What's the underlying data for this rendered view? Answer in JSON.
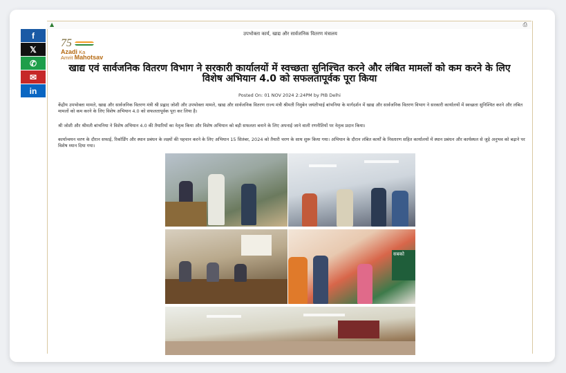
{
  "ministry_header": "उपभोक्ता कार्य, खाद्य और सार्वजनिक वितरण मंत्रालय",
  "logo": {
    "number": "75",
    "line1_prefix": "Azadi",
    "line1_suffix": "Ka",
    "line2_prefix": "Amrit",
    "line2_suffix": "Mahotsav"
  },
  "share_buttons": [
    {
      "label": "f",
      "icon": "facebook-icon",
      "color": "#1a5aa5"
    },
    {
      "label": "𝕏",
      "icon": "x-twitter-icon",
      "color": "#111111"
    },
    {
      "label": "✆",
      "icon": "whatsapp-icon",
      "color": "#1e9e4a"
    },
    {
      "label": "✉",
      "icon": "mail-icon",
      "color": "#c62828"
    },
    {
      "label": "in",
      "icon": "linkedin-icon",
      "color": "#0a66c2"
    }
  ],
  "headline": "खाद्य एवं सार्वजनिक वितरण विभाग ने सरकारी कार्यालयों में स्वच्छता सुनिश्चित करने और लंबित मामलों को कम करने के लिए विशेष अभियान 4.0 को सफलतापूर्वक पूरा किया",
  "posted": "Posted On: 01 NOV 2024 2:24PM by PIB Delhi",
  "paragraphs": [
    "केंद्रीय उपभोक्ता मामले, खाद्य और सार्वजनिक वितरण मंत्री श्री प्रह्लाद जोशी और उपभोक्ता मामले, खाद्य और सार्वजनिक वितरण राज्य मंत्री श्रीमती निमुबेन जयंतीभाई बांभनिया के मार्गदर्शन में खाद्य और सार्वजनिक वितरण विभाग ने सरकारी कार्यालयों में स्वच्छता सुनिश्चित करने और लंबित मामलों को कम करने के लिए विशेष अभियान 4.0 को सफलतापूर्वक पूरा कर लिया है।",
    "श्री जोशी और श्रीमती बांभनिया ने विशेष अभियान 4.0 की तैयारियों का नेतृत्व किया और विशेष अभियान को बड़ी सफलता बनाने के लिए अपनाई जाने वाली रणनीतियों पर नेतृत्व प्रदान किया।",
    "कार्यान्वयन चरण के दौरान सफाई, रिकॉर्डिंग और स्थान प्रबंधन के लक्ष्यों की पहचान करने के लिए अभियान 15 सितंबर, 2024 को तैयारी चरण के साथ शुरू किया गया। अभियान के दौरान लंबित कार्यों के निस्तारण सहित कार्यालयों में स्थान प्रबंधन और कार्यस्थल से जुड़े अनुभव को बढ़ाने पर विशेष ध्यान दिया गया।"
  ],
  "photo_banner_text": "सबको",
  "photo_banner_text2": "सबको"
}
